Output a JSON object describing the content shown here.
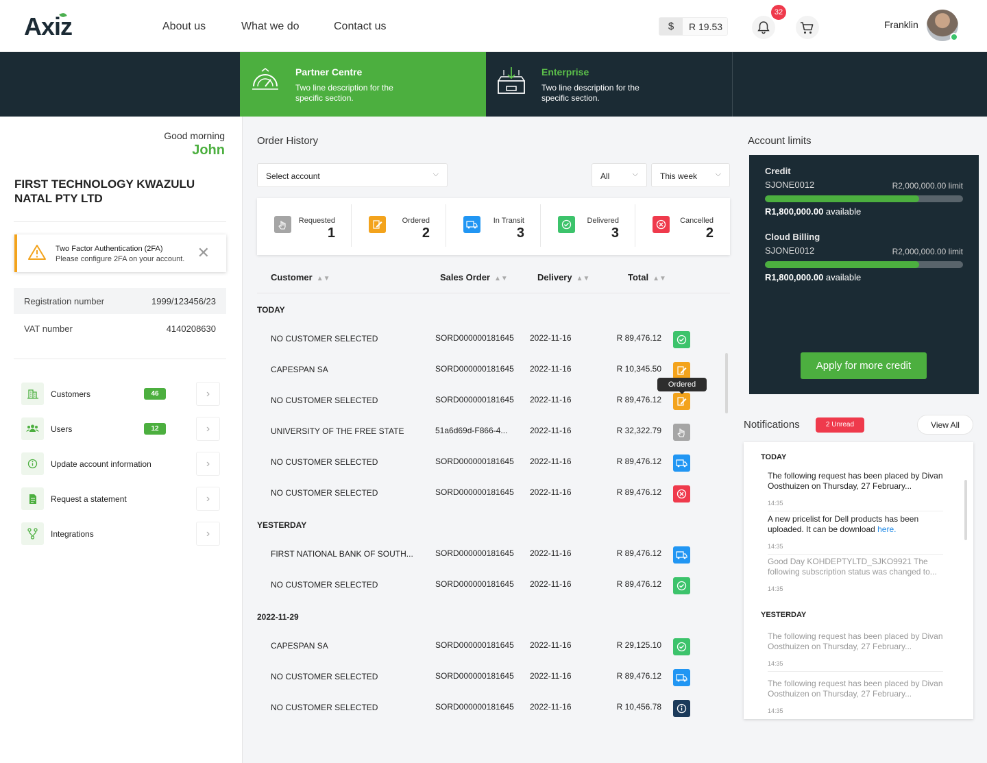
{
  "header": {
    "logo": "Axiz",
    "nav": [
      "About us",
      "What we do",
      "Contact us"
    ],
    "currency_symbol": "$",
    "balance": "R 19.53",
    "notification_count": "32",
    "user_name": "Franklin"
  },
  "banner": {
    "partner": {
      "title": "Partner Centre",
      "desc": "Two line description for the specific section."
    },
    "enterprise": {
      "title": "Enterprise",
      "desc": "Two line description for the specific section."
    }
  },
  "left": {
    "greeting": "Good morning",
    "name": "John",
    "company": "FIRST TECHNOLOGY KWAZULU NATAL PTY LTD",
    "twofa": {
      "title": "Two Factor Authentication (2FA)",
      "desc": "Please configure 2FA on your account."
    },
    "info": [
      {
        "label": "Registration number",
        "value": "1999/123456/23"
      },
      {
        "label": "VAT number",
        "value": "4140208630"
      }
    ],
    "menu": [
      {
        "label": "Customers",
        "count": "46",
        "icon": "building-icon"
      },
      {
        "label": "Users",
        "count": "12",
        "icon": "users-icon"
      },
      {
        "label": "Update account information",
        "icon": "info-icon"
      },
      {
        "label": "Request a statement",
        "icon": "document-icon"
      },
      {
        "label": "Integrations",
        "icon": "integrations-icon"
      }
    ]
  },
  "orders": {
    "title": "Order History",
    "account_select": "Select account",
    "filter_status": "All",
    "filter_period": "This week",
    "stats": [
      {
        "label": "Requested",
        "count": "1",
        "color": "#a5a5a5"
      },
      {
        "label": "Ordered",
        "count": "2",
        "color": "#f3a31c"
      },
      {
        "label": "In Transit",
        "count": "3",
        "color": "#2196f3"
      },
      {
        "label": "Delivered",
        "count": "3",
        "color": "#3cc36b"
      },
      {
        "label": "Cancelled",
        "count": "2",
        "color": "#ef3a4c"
      }
    ],
    "columns": [
      "Customer",
      "Sales Order",
      "Delivery",
      "Total"
    ],
    "tooltip": "Ordered",
    "groups": [
      {
        "label": "TODAY",
        "rows": [
          {
            "customer": "NO CUSTOMER SELECTED",
            "order": "SORD000000181645",
            "delivery": "2022-11-16",
            "total": "R 89,476.12",
            "status": "delivered"
          },
          {
            "customer": "CAPESPAN SA",
            "order": "SORD000000181645",
            "delivery": "2022-11-16",
            "total": "R 10,345.50",
            "status": "ordered"
          },
          {
            "customer": "NO CUSTOMER SELECTED",
            "order": "SORD000000181645",
            "delivery": "2022-11-16",
            "total": "R 89,476.12",
            "status": "ordered"
          },
          {
            "customer": "UNIVERSITY OF THE FREE STATE",
            "order": "51a6d69d-F866-4...",
            "delivery": "2022-11-16",
            "total": "R 32,322.79",
            "status": "requested"
          },
          {
            "customer": "NO CUSTOMER SELECTED",
            "order": "SORD000000181645",
            "delivery": "2022-11-16",
            "total": "R 89,476.12",
            "status": "transit"
          },
          {
            "customer": "NO CUSTOMER SELECTED",
            "order": "SORD000000181645",
            "delivery": "2022-11-16",
            "total": "R 89,476.12",
            "status": "cancelled"
          }
        ]
      },
      {
        "label": "YESTERDAY",
        "rows": [
          {
            "customer": "FIRST NATIONAL BANK OF SOUTH...",
            "order": "SORD000000181645",
            "delivery": "2022-11-16",
            "total": "R 89,476.12",
            "status": "transit"
          },
          {
            "customer": "NO CUSTOMER SELECTED",
            "order": "SORD000000181645",
            "delivery": "2022-11-16",
            "total": "R 89,476.12",
            "status": "delivered"
          }
        ]
      },
      {
        "label": "2022-11-29",
        "rows": [
          {
            "customer": "CAPESPAN SA",
            "order": "SORD000000181645",
            "delivery": "2022-11-16",
            "total": "R 29,125.10",
            "status": "delivered"
          },
          {
            "customer": "NO CUSTOMER SELECTED",
            "order": "SORD000000181645",
            "delivery": "2022-11-16",
            "total": "R 89,476.12",
            "status": "transit"
          },
          {
            "customer": "NO CUSTOMER SELECTED",
            "order": "SORD000000181645",
            "delivery": "2022-11-16",
            "total": "R 10,456.78",
            "status": "info"
          }
        ]
      }
    ]
  },
  "limits": {
    "title": "Account limits",
    "items": [
      {
        "title": "Credit",
        "code": "SJONE0012",
        "limit": "R2,000,000.00 limit",
        "available": "R1,800,000.00",
        "available_suffix": "available",
        "used_fraction": 0.78
      },
      {
        "title": "Cloud Billing",
        "code": "SJONE0012",
        "limit": "R2,000,000.00 limit",
        "available": "R1,800,000.00",
        "available_suffix": "available",
        "used_fraction": 0.78
      }
    ],
    "apply_label": "Apply for more credit"
  },
  "notifications": {
    "title": "Notifications",
    "unread": "2 Unread",
    "view_all": "View All",
    "groups": [
      {
        "label": "TODAY",
        "items": [
          {
            "text": "The following request has been placed by Divan Oosthuizen on Thursday, 27 February...",
            "time": "14:35",
            "read": false
          },
          {
            "text": "A new pricelist for Dell products has been uploaded. It can be download ",
            "link": "here.",
            "time": "14:35",
            "read": false
          },
          {
            "text": "Good Day KOHDEPTYLTD_SJKO9921 The following subscription status was changed to...",
            "time": "14:35",
            "read": true
          }
        ]
      },
      {
        "label": "YESTERDAY",
        "items": [
          {
            "text": "The following request has been placed by Divan Oosthuizen on Thursday, 27 February...",
            "time": "14:35",
            "read": true
          },
          {
            "text": "The following request has been placed by Divan Oosthuizen on Thursday, 27 February...",
            "time": "14:35",
            "read": true
          }
        ]
      }
    ]
  },
  "colors": {
    "brand_green": "#4caf3f",
    "dark": "#1b2b34",
    "red": "#ef3a4c"
  }
}
